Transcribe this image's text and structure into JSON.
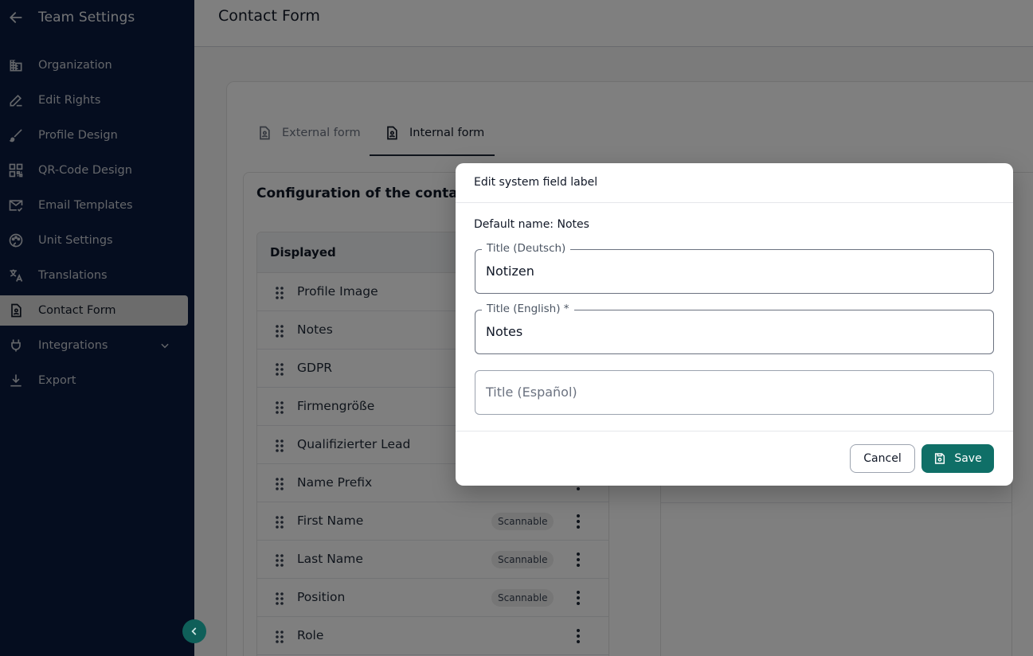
{
  "sidebar": {
    "title": "Team Settings",
    "items": [
      {
        "label": "Organization",
        "icon": "building-icon"
      },
      {
        "label": "Edit Rights",
        "icon": "pen-icon"
      },
      {
        "label": "Profile Design",
        "icon": "brush-icon"
      },
      {
        "label": "QR-Code Design",
        "icon": "qr-code-icon"
      },
      {
        "label": "Email Templates",
        "icon": "mail-icon"
      },
      {
        "label": "Unit Settings",
        "icon": "palette-icon"
      },
      {
        "label": "Translations",
        "icon": "translate-icon"
      },
      {
        "label": "Contact Form",
        "icon": "document-icon",
        "active": true
      },
      {
        "label": "Integrations",
        "icon": "plug-icon"
      },
      {
        "label": "Export",
        "icon": "download-icon"
      }
    ]
  },
  "header": {
    "title": "Contact Form"
  },
  "tabs": [
    {
      "label": "External form"
    },
    {
      "label": "Internal form",
      "active": true
    }
  ],
  "config": {
    "title": "Configuration of the contac",
    "displayed_header": "Displayed",
    "rows": [
      {
        "name": "Profile Image",
        "chip": ""
      },
      {
        "name": "Notes",
        "chip": ""
      },
      {
        "name": "GDPR",
        "chip": ""
      },
      {
        "name": "Firmengröße",
        "chip": ""
      },
      {
        "name": "Qualifizierter Lead",
        "chip": ""
      },
      {
        "name": "Name Prefix",
        "chip": ""
      },
      {
        "name": "First Name",
        "chip": "Scannable"
      },
      {
        "name": "Last Name",
        "chip": "Scannable"
      },
      {
        "name": "Position",
        "chip": "Scannable"
      },
      {
        "name": "Role",
        "chip": ""
      }
    ]
  },
  "dialog": {
    "title": "Edit system field label",
    "default_name": "Default name: Notes",
    "field_de": {
      "label": "Title (Deutsch)",
      "value": "Notizen"
    },
    "field_en": {
      "label": "Title (English) *",
      "value": "Notes"
    },
    "field_es": {
      "placeholder": "Title (Español)"
    },
    "cancel": "Cancel",
    "save": "Save"
  },
  "colors": {
    "sidebar": "#0a1a3e",
    "accent": "#0f6f67"
  }
}
